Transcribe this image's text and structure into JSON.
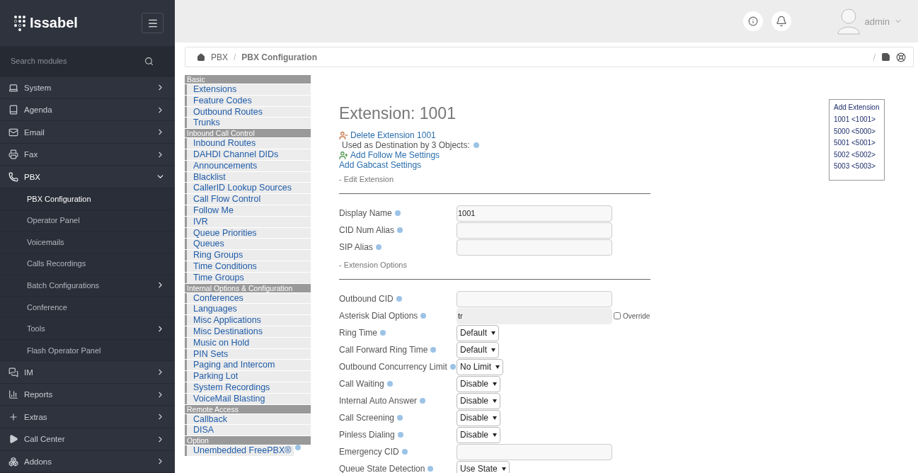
{
  "brand": {
    "name": "Issabel"
  },
  "search": {
    "placeholder": "Search modules"
  },
  "sidebar": {
    "items": [
      {
        "label": "System",
        "expanded": false
      },
      {
        "label": "Agenda",
        "expanded": false
      },
      {
        "label": "Email",
        "expanded": false
      },
      {
        "label": "Fax",
        "expanded": false
      },
      {
        "label": "PBX",
        "expanded": true,
        "children": [
          {
            "label": "PBX Configuration",
            "selected": true,
            "has_submenu": false
          },
          {
            "label": "Operator Panel",
            "selected": false,
            "has_submenu": false
          },
          {
            "label": "Voicemails",
            "selected": false,
            "has_submenu": false
          },
          {
            "label": "Calls Recordings",
            "selected": false,
            "has_submenu": false
          },
          {
            "label": "Batch Configurations",
            "selected": false,
            "has_submenu": true
          },
          {
            "label": "Conference",
            "selected": false,
            "has_submenu": false
          },
          {
            "label": "Tools",
            "selected": false,
            "has_submenu": true
          },
          {
            "label": "Flash Operator Panel",
            "selected": false,
            "has_submenu": false
          }
        ]
      },
      {
        "label": "IM",
        "expanded": false
      },
      {
        "label": "Reports",
        "expanded": false
      },
      {
        "label": "Extras",
        "expanded": false
      },
      {
        "label": "Call Center",
        "expanded": false
      },
      {
        "label": "Addons",
        "expanded": false
      }
    ]
  },
  "user": {
    "name": "admin"
  },
  "breadcrumb": {
    "separator": "/",
    "items": [
      "PBX",
      "PBX Configuration"
    ]
  },
  "nav": [
    {
      "title": "Basic",
      "items": [
        "Extensions",
        "Feature Codes",
        "Outbound Routes",
        "Trunks"
      ],
      "help": false
    },
    {
      "title": "Inbound Call Control",
      "items": [
        "Inbound Routes",
        "DAHDI Channel DIDs",
        "Announcements",
        "Blacklist",
        "CallerID Lookup Sources",
        "Call Flow Control",
        "Follow Me",
        "IVR",
        "Queue Priorities",
        "Queues",
        "Ring Groups",
        "Time Conditions",
        "Time Groups"
      ],
      "help": false
    },
    {
      "title": "Internal Options & Configuration",
      "items": [
        "Conferences",
        "Languages",
        "Misc Applications",
        "Misc Destinations",
        "Music on Hold",
        "PIN Sets",
        "Paging and Intercom",
        "Parking Lot",
        "System Recordings",
        "VoiceMail Blasting"
      ],
      "help": false
    },
    {
      "title": "Remote Access",
      "items": [
        "Callback",
        "DISA"
      ],
      "help": false
    },
    {
      "title": "Option",
      "items": [
        "Unembedded FreePBX®"
      ],
      "help": true
    }
  ],
  "page": {
    "title": "Extension: 1001",
    "actions": [
      {
        "kind": "delete",
        "text": "Delete Extension 1001"
      },
      {
        "kind": "info",
        "text": "Used as Destination by 3 Objects:"
      },
      {
        "kind": "add",
        "text": "Add Follow Me Settings"
      },
      {
        "kind": "plain",
        "text": "Add Gabcast Settings"
      }
    ],
    "sections": [
      {
        "title": "- Edit Extension",
        "fields": [
          {
            "label": "Display Name",
            "kind": "text",
            "value": "1001",
            "disabled": false
          },
          {
            "label": "CID Num Alias",
            "kind": "text",
            "disabled": false
          },
          {
            "label": "SIP Alias",
            "kind": "text",
            "disabled": false
          }
        ]
      },
      {
        "title": "- Extension Options",
        "fields": [
          {
            "label": "Outbound CID",
            "kind": "text",
            "disabled": false
          },
          {
            "label": "Asterisk Dial Options",
            "kind": "text",
            "value": "tr",
            "disabled": true,
            "override": {
              "label": "Override",
              "checked": false
            }
          },
          {
            "label": "Ring Time",
            "kind": "select",
            "value": "Default"
          },
          {
            "label": "Call Forward Ring Time",
            "kind": "select",
            "value": "Default"
          },
          {
            "label": "Outbound Concurrency Limit",
            "kind": "select",
            "value": "No Limit"
          },
          {
            "label": "Call Waiting",
            "kind": "select",
            "value": "Disable"
          },
          {
            "label": "Internal Auto Answer",
            "kind": "select",
            "value": "Disable"
          },
          {
            "label": "Call Screening",
            "kind": "select",
            "value": "Disable"
          },
          {
            "label": "Pinless Dialing",
            "kind": "select",
            "value": "Disable"
          },
          {
            "label": "Emergency CID",
            "kind": "text",
            "disabled": false
          },
          {
            "label": "Queue State Detection",
            "kind": "select",
            "value": "Use State"
          }
        ]
      }
    ]
  },
  "extension_list": {
    "title": "Add Extension",
    "items": [
      "1001 <1001>",
      "5000 <5000>",
      "5001 <5001>",
      "5002 <5002>",
      "5003 <5003>"
    ]
  }
}
